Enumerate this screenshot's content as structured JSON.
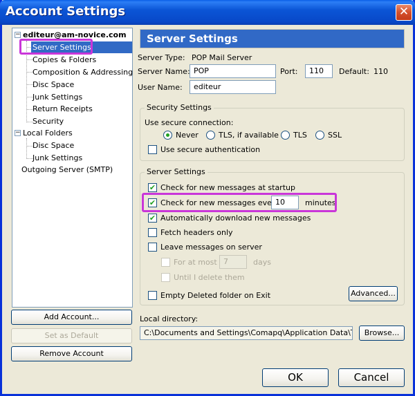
{
  "window": {
    "title": "Account Settings",
    "close_icon": "close-icon"
  },
  "tree": {
    "accounts": [
      {
        "label": "editeur@am-novice.com",
        "expanded": true,
        "children": [
          "Server Settings",
          "Copies & Folders",
          "Composition & Addressing",
          "Disc Space",
          "Junk Settings",
          "Return Receipts",
          "Security"
        ]
      },
      {
        "label": "Local Folders",
        "expanded": true,
        "children": [
          "Disc Space",
          "Junk Settings"
        ]
      }
    ],
    "outgoing": "Outgoing Server (SMTP)",
    "selected": "Server Settings"
  },
  "left_buttons": {
    "add_account": "Add Account...",
    "set_default": "Set as Default",
    "remove_account": "Remove Account"
  },
  "panel": {
    "header": "Server Settings",
    "server_type_label": "Server Type:",
    "server_type_value": "POP Mail Server",
    "server_name_label": "Server Name:",
    "server_name_value": "POP",
    "port_label": "Port:",
    "port_value": "110",
    "default_label": "Default:",
    "default_value": "110",
    "user_name_label": "User Name:",
    "user_name_value": "editeur"
  },
  "security": {
    "title": "Security Settings",
    "use_secure_label": "Use secure connection:",
    "options": [
      {
        "label": "Never",
        "selected": true
      },
      {
        "label": "TLS, if available",
        "selected": false
      },
      {
        "label": "TLS",
        "selected": false
      },
      {
        "label": "SSL",
        "selected": false
      }
    ],
    "secure_auth": {
      "label": "Use secure authentication",
      "checked": false
    }
  },
  "server_settings": {
    "title": "Server Settings",
    "check_startup": {
      "label": "Check for new messages at startup",
      "checked": true
    },
    "check_every": {
      "label": "Check for new messages every",
      "checked": true,
      "value": "10",
      "unit": "minutes"
    },
    "auto_download": {
      "label": "Automatically download new messages",
      "checked": true
    },
    "fetch_headers": {
      "label": "Fetch headers only",
      "checked": false
    },
    "leave_on_server": {
      "label": "Leave messages on server",
      "checked": false
    },
    "for_at_most": {
      "label": "For at most",
      "checked": false,
      "value": "7",
      "unit": "days",
      "disabled": true
    },
    "until_delete": {
      "label": "Until I delete them",
      "checked": false,
      "disabled": true
    },
    "empty_deleted": {
      "label": "Empty Deleted folder on Exit",
      "checked": false
    },
    "advanced_button": "Advanced..."
  },
  "local_directory": {
    "label": "Local directory:",
    "value": "C:\\Documents and Settings\\Comapq\\Application Data\\Thunderb",
    "browse_button": "Browse..."
  },
  "dialog_buttons": {
    "ok": "OK",
    "cancel": "Cancel"
  },
  "annotation_color": "#c936d9"
}
